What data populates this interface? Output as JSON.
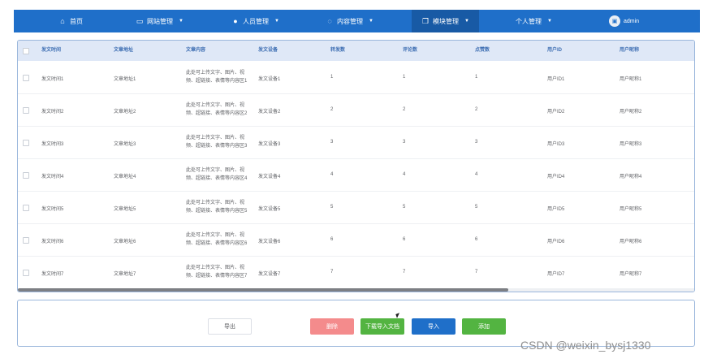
{
  "nav": {
    "items": [
      {
        "label": "首页",
        "icon": "home-icon"
      },
      {
        "label": "网站管理",
        "icon": "monitor-icon"
      },
      {
        "label": "人员管理",
        "icon": "user-icon"
      },
      {
        "label": "内容管理",
        "icon": "chat-icon"
      },
      {
        "label": "模块管理",
        "icon": "copy-icon"
      },
      {
        "label": "个人管理",
        "icon": ""
      }
    ],
    "user": "admin"
  },
  "table": {
    "columns": [
      "发文时间",
      "文章地址",
      "文章内容",
      "发文设备",
      "转发数",
      "评论数",
      "点赞数",
      "用户ID",
      "用户昵称"
    ],
    "rows": [
      [
        "发文时间1",
        "文章地址1",
        "此处可上传文字、图片、视频、超链接、表情等内容区1",
        "发文设备1",
        "1",
        "1",
        "1",
        "用户ID1",
        "用户昵称1"
      ],
      [
        "发文时间2",
        "文章地址2",
        "此处可上传文字、图片、视频、超链接、表情等内容区2",
        "发文设备2",
        "2",
        "2",
        "2",
        "用户ID2",
        "用户昵称2"
      ],
      [
        "发文时间3",
        "文章地址3",
        "此处可上传文字、图片、视频、超链接、表情等内容区3",
        "发文设备3",
        "3",
        "3",
        "3",
        "用户ID3",
        "用户昵称3"
      ],
      [
        "发文时间4",
        "文章地址4",
        "此处可上传文字、图片、视频、超链接、表情等内容区4",
        "发文设备4",
        "4",
        "4",
        "4",
        "用户ID4",
        "用户昵称4"
      ],
      [
        "发文时间5",
        "文章地址5",
        "此处可上传文字、图片、视频、超链接、表情等内容区5",
        "发文设备5",
        "5",
        "5",
        "5",
        "用户ID5",
        "用户昵称5"
      ],
      [
        "发文时间6",
        "文章地址6",
        "此处可上传文字、图片、视频、超链接、表情等内容区6",
        "发文设备6",
        "6",
        "6",
        "6",
        "用户ID6",
        "用户昵称6"
      ],
      [
        "发文时间7",
        "文章地址7",
        "此处可上传文字、图片、视频、超链接、表情等内容区7",
        "发文设备7",
        "7",
        "7",
        "7",
        "用户ID7",
        "用户昵称7"
      ]
    ]
  },
  "actions": {
    "export": "导出",
    "delete": "删除",
    "download": "下载导入文档",
    "import": "导入",
    "add": "添加"
  },
  "watermark": "CSDN @weixin_bysj1330",
  "colors": {
    "nav_bg": "#1f6fc9",
    "delete": "#f48b8c",
    "success": "#53b441",
    "primary": "#1f6fc9"
  }
}
